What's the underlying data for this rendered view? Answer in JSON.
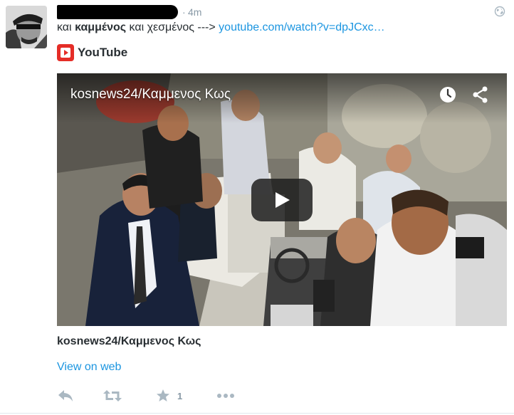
{
  "tweet": {
    "time_sep": "·",
    "time": "4m",
    "text": {
      "part1": "και ",
      "bold": "καμμένος",
      "part2": " και χεσμένος ---> ",
      "link": "youtube.com/watch?v=dpJCxc…"
    }
  },
  "card": {
    "source_name": "YouTube",
    "video_title": "kosnews24/Καμμενος Κως",
    "title": "kosnews24/Καμμενος Κως",
    "view_on_web": "View on web"
  },
  "actions": {
    "favorite_count": "1"
  },
  "icons": {
    "avatar": "avatar",
    "privacy": "globe-icon",
    "source": "youtube-logo-icon",
    "watch_later": "clock-icon",
    "share": "share-icon",
    "play": "play-icon",
    "reply": "reply-icon",
    "retweet": "retweet-icon",
    "favorite": "star-icon",
    "more": "more-icon"
  },
  "colors": {
    "link": "#1b95e0",
    "muted": "#8899a6",
    "text": "#292f33",
    "youtube_red": "#e52d27"
  }
}
